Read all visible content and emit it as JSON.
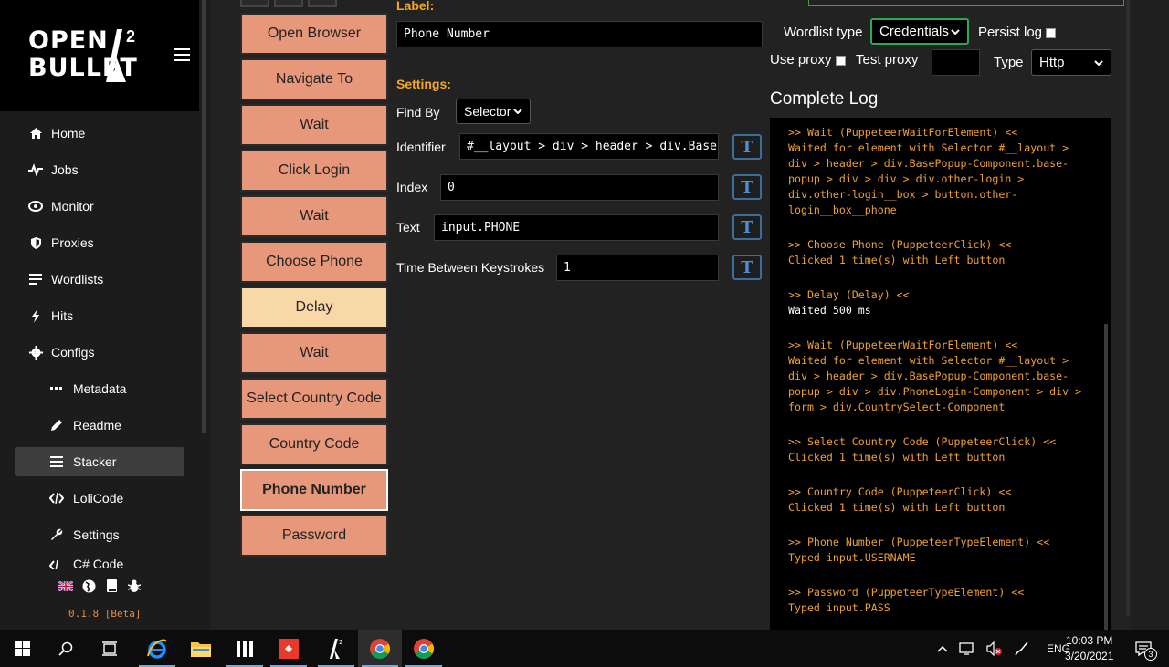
{
  "sidebar": {
    "logo_line1": "OPEN",
    "logo_line2": "BULLET",
    "logo_sup": "2",
    "items": [
      {
        "label": "Home",
        "icon": "home-icon"
      },
      {
        "label": "Jobs",
        "icon": "pulse-icon"
      },
      {
        "label": "Monitor",
        "icon": "eye-icon"
      },
      {
        "label": "Proxies",
        "icon": "shield-icon"
      },
      {
        "label": "Wordlists",
        "icon": "list-icon"
      },
      {
        "label": "Hits",
        "icon": "bolt-icon"
      },
      {
        "label": "Configs",
        "icon": "gear-icon"
      },
      {
        "label": "Metadata",
        "icon": "dots-icon"
      },
      {
        "label": "Readme",
        "icon": "pencil-icon"
      },
      {
        "label": "Stacker",
        "icon": "menu-icon"
      },
      {
        "label": "LoliCode",
        "icon": "code-icon"
      },
      {
        "label": "Settings",
        "icon": "wrench-icon"
      },
      {
        "label": "C# Code",
        "icon": "code-icon"
      }
    ],
    "version": "0.1.8 [Beta]"
  },
  "stack": {
    "blocks": [
      "Open Browser",
      "Navigate To",
      "Wait",
      "Click Login",
      "Wait",
      "Choose Phone",
      "Delay",
      "Wait",
      "Select Country Code",
      "Country Code",
      "Phone Number",
      "Password"
    ]
  },
  "settings": {
    "label_title": "Label:",
    "label_value": "Phone Number",
    "settings_title": "Settings:",
    "find_by_label": "Find By",
    "find_by_value": "Selector",
    "identifier_label": "Identifier",
    "identifier_value": "#__layout > div > header > div.Base",
    "index_label": "Index",
    "index_value": "0",
    "text_label": "Text",
    "text_value": "input.PHONE",
    "keystrokes_label": "Time Between Keystrokes",
    "keystrokes_value": "1",
    "t_button": "T"
  },
  "debugger": {
    "wordlist_type_label": "Wordlist type",
    "wordlist_type_value": "Credentials",
    "persist_log_label": "Persist log",
    "use_proxy_label": "Use proxy",
    "test_proxy_label": "Test proxy",
    "type_label": "Type",
    "type_value": "Http",
    "log_title": "Complete Log"
  },
  "log": [
    {
      "head": ">> Wait (PuppeteerWaitForElement) <<",
      "body": "Waited for element with Selector #__layout > div > header > div.BasePopup-Component.base-popup > div > div > div.other-login > div.other-login__box > button.other-login__box__phone",
      "white": false
    },
    {
      "head": ">> Choose Phone (PuppeteerClick) <<",
      "body": "Clicked 1 time(s) with Left button",
      "white": false
    },
    {
      "head": ">> Delay (Delay) <<",
      "body": "Waited 500 ms",
      "white": true
    },
    {
      "head": ">> Wait (PuppeteerWaitForElement) <<",
      "body": "Waited for element with Selector #__layout > div > header > div.BasePopup-Component.base-popup > div > div.PhoneLogin-Component > div > form > div.CountrySelect-Component",
      "white": false
    },
    {
      "head": ">> Select Country Code (PuppeteerClick) <<",
      "body": "Clicked 1 time(s) with Left button",
      "white": false
    },
    {
      "head": ">> Country Code (PuppeteerClick) <<",
      "body": "Clicked 1 time(s) with Left button",
      "white": false
    },
    {
      "head": ">> Phone Number (PuppeteerTypeElement) <<",
      "body": "Typed input.USERNAME",
      "white": false
    },
    {
      "head": ">> Password (PuppeteerTypeElement) <<",
      "body": "Typed input.PASS",
      "white": false
    }
  ],
  "taskbar": {
    "lang": "ENG",
    "time": "10:03 PM",
    "date": "3/20/2021",
    "notifications": "3"
  },
  "colors": {
    "accent_orange": "#f5a623",
    "block_salmon": "#e8987a",
    "block_delay": "#f9d8a8",
    "t_button_blue": "#4d8fd1",
    "select_green": "#2da84a"
  }
}
